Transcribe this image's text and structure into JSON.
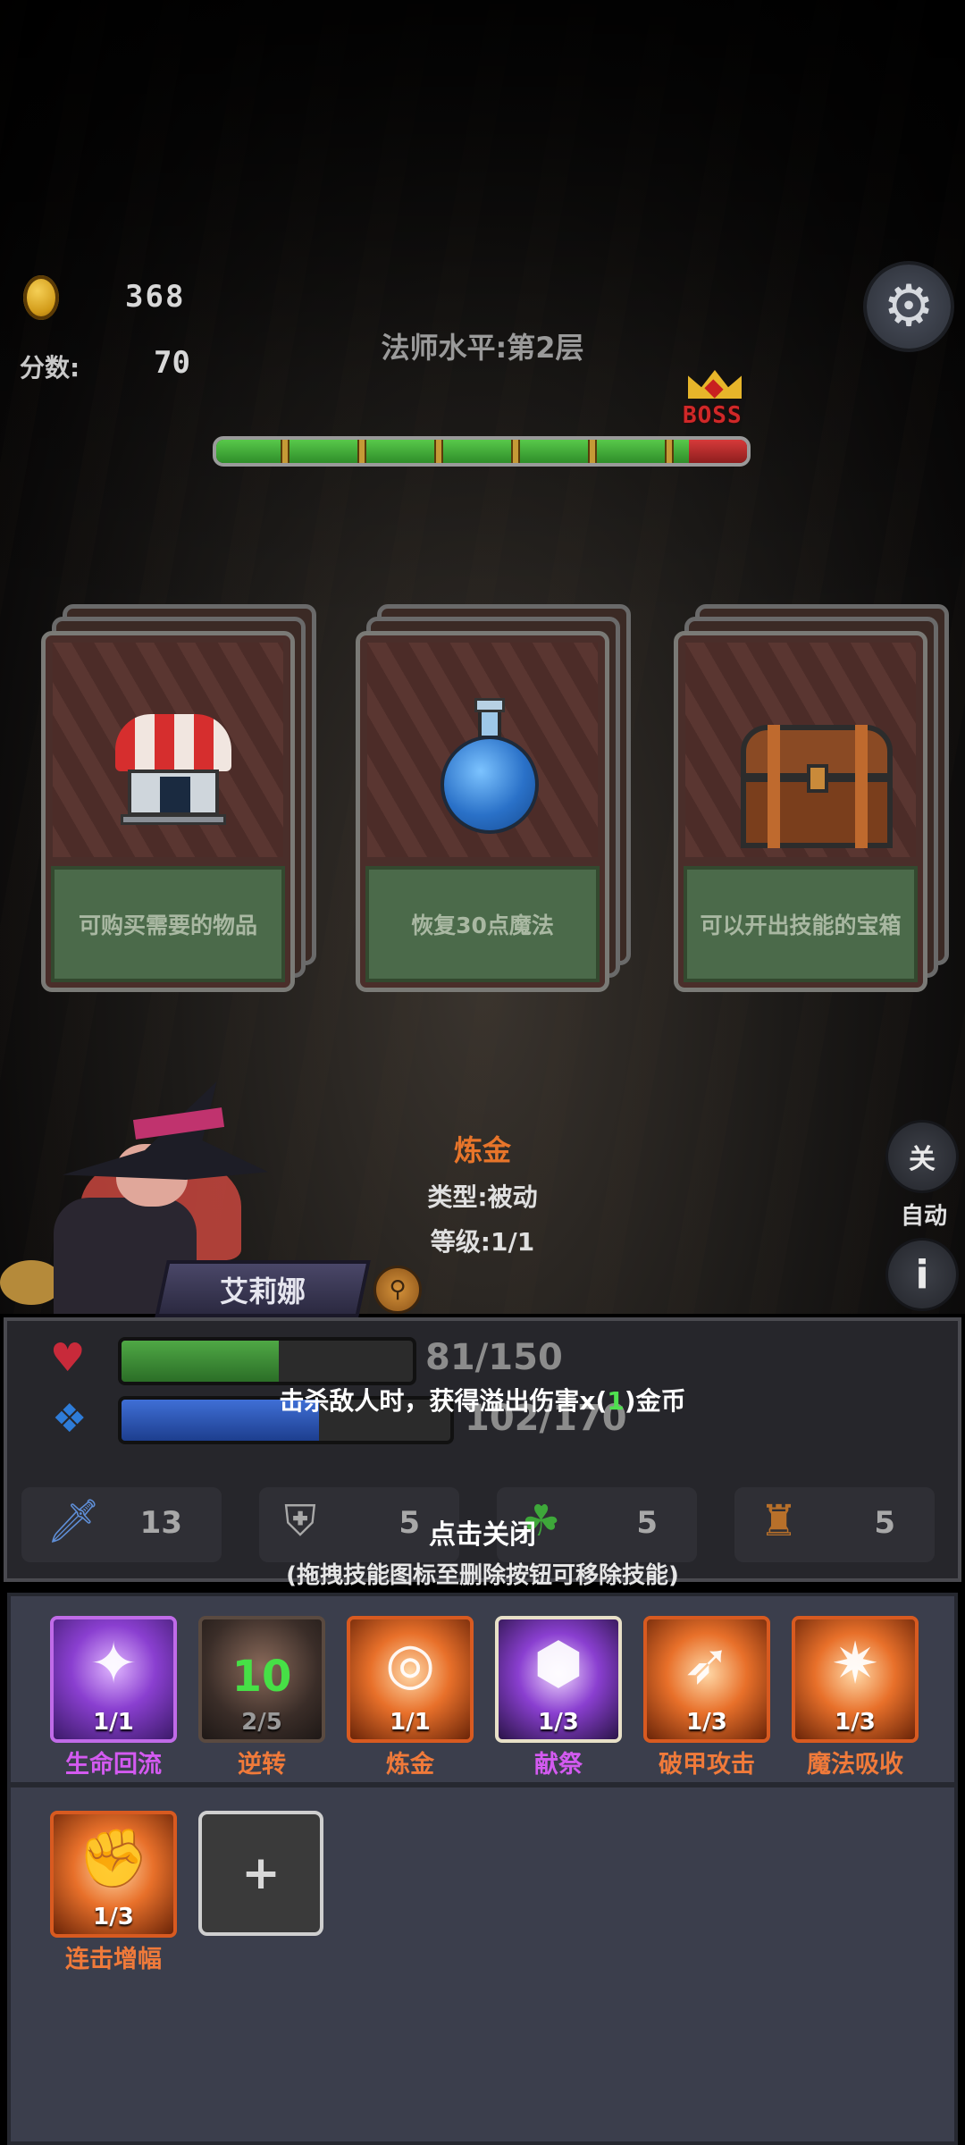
{
  "hud": {
    "coins": "368",
    "score_label": "分数:",
    "score_value": "70",
    "level_text": "法师水平:第2层",
    "boss_label": "BOSS",
    "progress": 0.89,
    "settings_icon": "gear-icon"
  },
  "cards": [
    {
      "icon": "shop-icon",
      "desc": "可购买需要的物品"
    },
    {
      "icon": "potion-icon",
      "desc": "恢复30点魔法"
    },
    {
      "icon": "chest-icon",
      "desc": "可以开出技能的宝箱"
    }
  ],
  "skill_info": {
    "name": "炼金",
    "type": "类型:被动",
    "level": "等级:1/1"
  },
  "side": {
    "toggle_label": "关",
    "auto_label": "自动",
    "info_label": "i"
  },
  "character": {
    "name": "艾莉娜"
  },
  "stats": {
    "hp_text": "81/150",
    "hp_ratio": 0.54,
    "mp_text": "102/170",
    "mp_ratio": 0.6,
    "tooltip_prefix": "击杀敌人时，获得溢出伤害x",
    "tooltip_paren_open": "(",
    "tooltip_value": "1",
    "tooltip_paren_close": ")",
    "tooltip_suffix": "金币",
    "attack": "13",
    "defense": "5",
    "luck": "5",
    "gold_bag": "5",
    "close_hint": "点击关闭",
    "drag_hint": "(拖拽技能图标至删除按钮可移除技能)"
  },
  "skills": [
    {
      "name": "生命回流",
      "level": "1/1",
      "style": "purple",
      "glyph": "✦",
      "label_color": "#d35af0"
    },
    {
      "name": "逆转",
      "level": "2/5",
      "style": "dark",
      "glyph": "10",
      "label_color": "#f07a3a"
    },
    {
      "name": "炼金",
      "level": "1/1",
      "style": "orange",
      "glyph": "◎",
      "label_color": "#f07a3a"
    },
    {
      "name": "献祭",
      "level": "1/3",
      "style": "purple2",
      "glyph": "⬢",
      "label_color": "#d35af0"
    },
    {
      "name": "破甲攻击",
      "level": "1/3",
      "style": "orange",
      "glyph": "➶",
      "label_color": "#f07a3a"
    },
    {
      "name": "魔法吸收",
      "level": "1/3",
      "style": "orange",
      "glyph": "✷",
      "label_color": "#f07a3a"
    },
    {
      "name": "连击增幅",
      "level": "1/3",
      "style": "orange",
      "glyph": "✊",
      "label_color": "#f07a3a"
    }
  ],
  "add_slot": "+"
}
